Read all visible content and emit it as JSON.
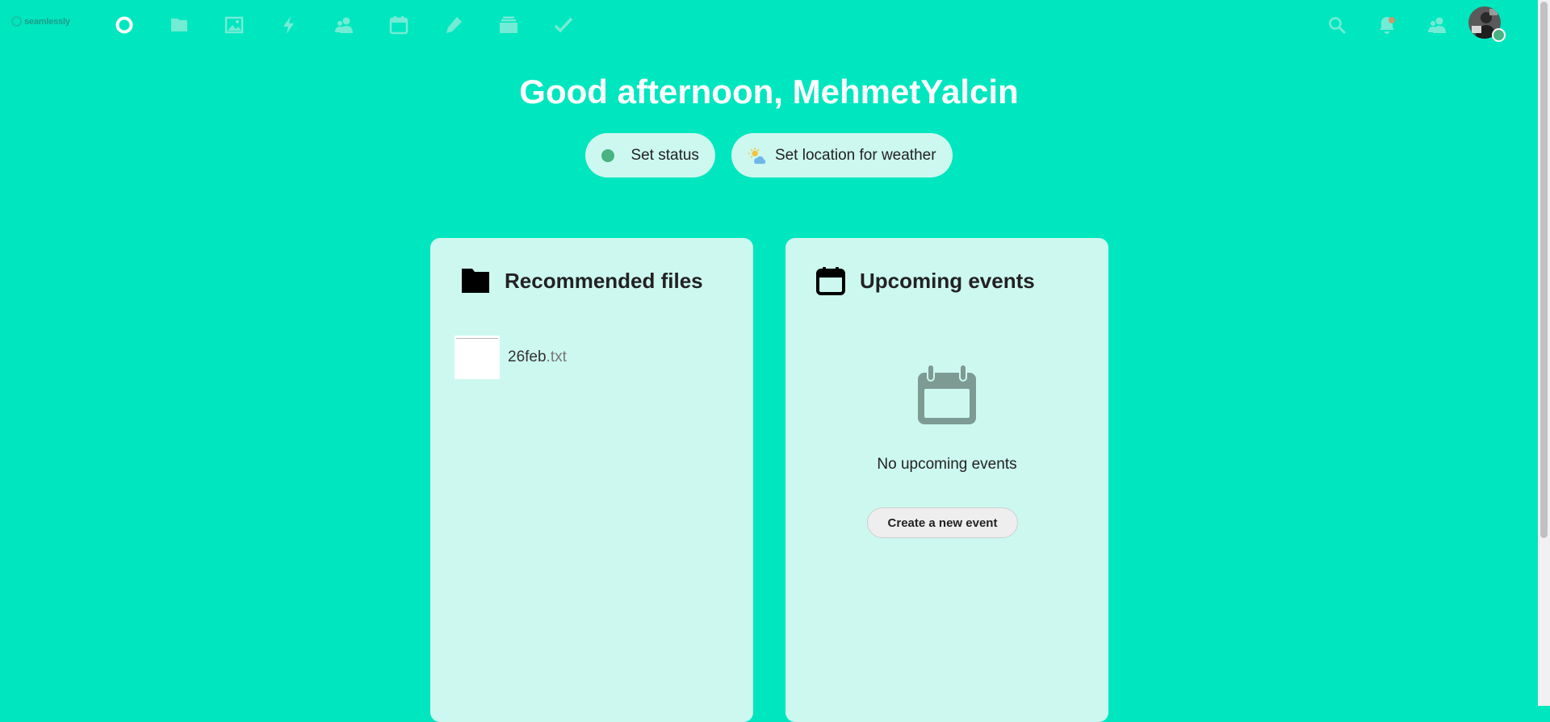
{
  "header": {
    "logo_text": "seamlessly",
    "nav_items": [
      {
        "name": "dashboard-icon",
        "label": "Dashboard"
      },
      {
        "name": "files-icon",
        "label": "Files"
      },
      {
        "name": "photos-icon",
        "label": "Photos"
      },
      {
        "name": "activity-icon",
        "label": "Activity"
      },
      {
        "name": "contacts-icon",
        "label": "Contacts"
      },
      {
        "name": "calendar-icon",
        "label": "Calendar"
      },
      {
        "name": "notes-icon",
        "label": "Notes"
      },
      {
        "name": "deck-icon",
        "label": "Deck"
      },
      {
        "name": "tasks-icon",
        "label": "Tasks"
      }
    ],
    "right_icons": [
      "search-icon",
      "notifications-icon",
      "contacts-menu-icon"
    ],
    "avatar_status_color": "#49b382"
  },
  "greeting": "Good afternoon, MehmetYalcin",
  "status": {
    "set_status_label": "Set status",
    "weather_label": "Set location for weather",
    "status_color": "#49b382"
  },
  "panels": {
    "files": {
      "title": "Recommended files",
      "icon": "folder-icon",
      "items": [
        {
          "name": "26feb",
          "ext": ".txt"
        }
      ]
    },
    "events": {
      "title": "Upcoming events",
      "icon": "calendar-icon",
      "empty_text": "No upcoming events",
      "create_label": "Create a new event"
    }
  },
  "colors": {
    "background": "#00e6bf",
    "panel": "#ccf8ef",
    "icon_muted": "#73ecd5"
  }
}
